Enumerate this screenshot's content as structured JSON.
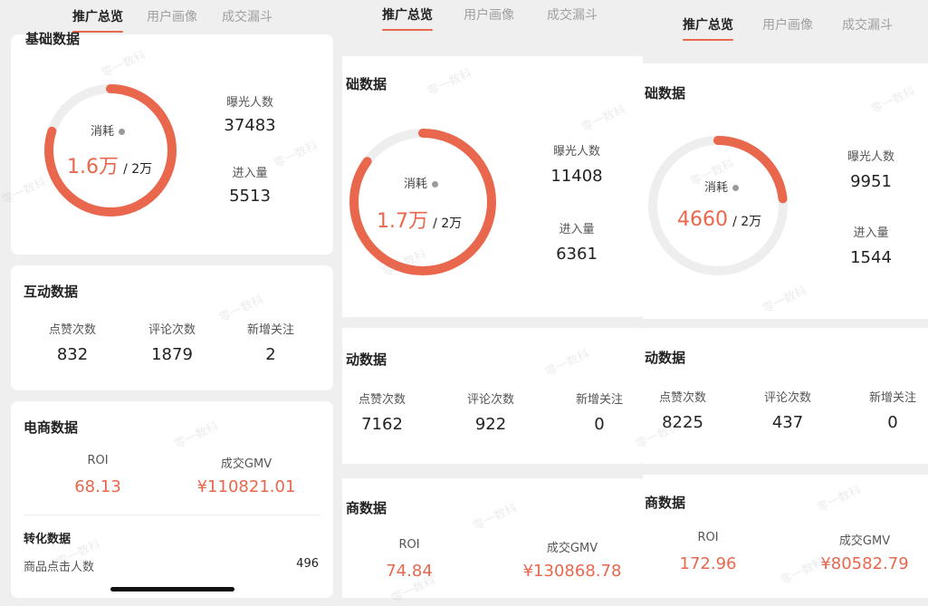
{
  "panels": [
    {
      "tabs": [
        "推广总览",
        "用户画像",
        "成交漏斗"
      ],
      "basic": {
        "title": "基础数据",
        "consume_label": "消耗",
        "consume_value": "1.6万",
        "consume_target": "/ 2万",
        "progress": 0.8,
        "exposure_label": "曝光人数",
        "exposure_value": "37483",
        "entry_label": "进入量",
        "entry_value": "5513"
      },
      "interaction": {
        "title": "互动数据",
        "likes_label": "点赞次数",
        "likes_value": "832",
        "comments_label": "评论次数",
        "comments_value": "1879",
        "follows_label": "新增关注",
        "follows_value": "2"
      },
      "ecommerce": {
        "title": "电商数据",
        "roi_label": "ROI",
        "roi_value": "68.13",
        "gmv_label": "成交GMV",
        "gmv_value": "¥110821.01"
      },
      "conversion": {
        "title": "转化数据",
        "click_label": "商品点击人数",
        "click_value": "496"
      }
    },
    {
      "tabs": [
        "推广总览",
        "用户画像",
        "成交漏斗"
      ],
      "basic": {
        "title": "础数据",
        "consume_label": "消耗",
        "consume_value": "1.7万",
        "consume_target": "/ 2万",
        "progress": 0.85,
        "exposure_label": "曝光人数",
        "exposure_value": "11408",
        "entry_label": "进入量",
        "entry_value": "6361"
      },
      "interaction": {
        "title": "动数据",
        "likes_label": "点赞次数",
        "likes_value": "7162",
        "comments_label": "评论次数",
        "comments_value": "922",
        "follows_label": "新增关注",
        "follows_value": "0"
      },
      "ecommerce": {
        "title": "商数据",
        "roi_label": "ROI",
        "roi_value": "74.84",
        "gmv_label": "成交GMV",
        "gmv_value": "¥130868.78"
      }
    },
    {
      "tabs": [
        "推广总览",
        "用户画像",
        "成交漏斗"
      ],
      "basic": {
        "title": "础数据",
        "consume_label": "消耗",
        "consume_value": "4660",
        "consume_target": "/ 2万",
        "progress": 0.233,
        "exposure_label": "曝光人数",
        "exposure_value": "9951",
        "entry_label": "进入量",
        "entry_value": "1544"
      },
      "interaction": {
        "title": "动数据",
        "likes_label": "点赞次数",
        "likes_value": "8225",
        "comments_label": "评论次数",
        "comments_value": "437",
        "follows_label": "新增关注",
        "follows_value": "0"
      },
      "ecommerce": {
        "title": "商数据",
        "roi_label": "ROI",
        "roi_value": "172.96",
        "gmv_label": "成交GMV",
        "gmv_value": "¥80582.79"
      }
    }
  ],
  "watermark": "零一数科",
  "colors": {
    "accent": "#e8674d",
    "track": "#eeeeee",
    "card": "#ffffff",
    "bg": "#efefef"
  }
}
